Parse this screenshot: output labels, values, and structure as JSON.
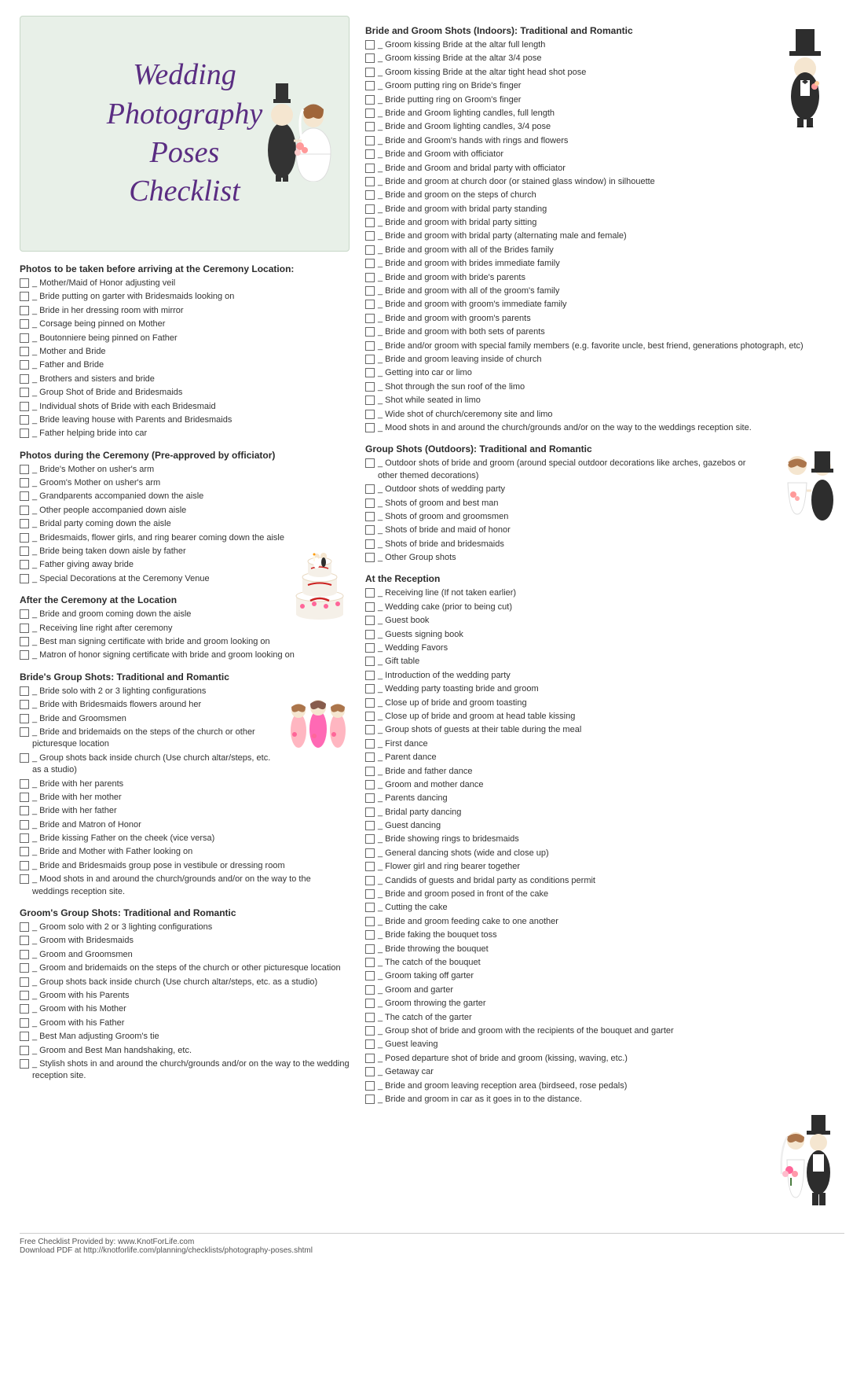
{
  "title": {
    "line1": "Wedding",
    "line2": "Photography",
    "line3": "Poses",
    "line4": "Checklist"
  },
  "sections": {
    "before_ceremony": {
      "header": "Photos to be taken before arriving at the Ceremony Location:",
      "items": [
        "Mother/Maid of Honor adjusting veil",
        "Bride putting on garter with Bridesmaids looking on",
        "Bride in her dressing room with mirror",
        "Corsage being pinned on Mother",
        "Boutonniere being pinned on Father",
        "Mother and Bride",
        "Father and Bride",
        "Brothers and sisters and bride",
        "Group Shot of Bride and Bridesmaids",
        "Individual shots of Bride with each Bridesmaid",
        "Bride leaving house with Parents and Bridesmaids",
        "Father helping bride into car"
      ]
    },
    "during_ceremony": {
      "header": "Photos during the Ceremony (Pre-approved by officiator)",
      "items": [
        "Bride's Mother on usher's arm",
        "Groom's Mother on usher's arm",
        "Grandparents accompanied down the aisle",
        "Other people accompanied down aisle",
        "Bridal party coming down the aisle",
        "Bridesmaids, flower girls, and ring bearer coming down the aisle",
        "Bride being taken down aisle by father",
        "Father giving away bride",
        "Special Decorations at the Ceremony Venue"
      ]
    },
    "after_ceremony": {
      "header": "After the Ceremony at the Location",
      "items": [
        "Bride and groom coming down the aisle",
        "Receiving line right after ceremony",
        "Best man signing certificate with bride and groom looking on",
        "Matron of honor signing certificate with bride and groom looking on"
      ]
    },
    "brides_group": {
      "header": "Bride's Group Shots: Traditional and Romantic",
      "items": [
        "Bride solo with 2 or 3 lighting configurations",
        "Bride with Bridesmaids flowers around her",
        "Bride and Groomsmen",
        "Bride and bridemaids on the steps of the church or other picturesque location",
        "Group shots back inside church  (Use church altar/steps, etc. as a studio)",
        "Bride with her parents",
        "Bride with her mother",
        "Bride with her father",
        "Bride and Matron of Honor",
        "Bride kissing Father on the cheek (vice versa)",
        "Bride and Mother with Father looking on",
        "Bride and Bridesmaids group pose in vestibule or dressing room",
        "Mood shots in and around the church/grounds and/or  on the way to the weddings reception site."
      ]
    },
    "grooms_group": {
      "header": "Groom's Group Shots: Traditional and Romantic",
      "items": [
        "Groom solo with 2 or 3 lighting configurations",
        "Groom with Bridesmaids",
        "Groom and Groomsmen",
        "Groom and bridemaids on the steps of the church or other picturesque location",
        "Group shots back inside church  (Use church altar/steps, etc. as a studio)",
        "Groom with his Parents",
        "Groom with his Mother",
        "Groom with his Father",
        "Best Man adjusting Groom's tie",
        "Groom and Best Man handshaking, etc.",
        "Stylish shots in and around the church/grounds and/or  on the way to the wedding reception site."
      ]
    },
    "bride_groom_indoors": {
      "header": "Bride and Groom Shots (Indoors): Traditional and Romantic",
      "items": [
        "Groom kissing Bride at the altar full length",
        "Groom kissing Bride at the altar 3/4 pose",
        "Groom kissing Bride at the altar tight head shot pose",
        "Groom putting ring on Bride's finger",
        "Bride putting ring on Groom's finger",
        "Bride and Groom lighting candles, full length",
        "Bride and Groom lighting candles, 3/4 pose",
        "Bride and Groom's hands with rings and flowers",
        "Bride and Groom with officiator",
        "Bride and Groom and bridal party with officiator",
        "Bride and groom at church door (or stained glass window) in silhouette",
        "Bride and groom on the steps of church",
        "Bride and groom with bridal party standing",
        "Bride and groom with bridal party sitting",
        "Bride and groom with bridal party  (alternating male and female)",
        "Bride and groom with all of the Brides family",
        "Bride and groom with brides immediate family",
        "Bride and groom with bride's parents",
        "Bride and groom with all of the groom's family",
        "Bride and groom with groom's immediate family",
        "Bride and groom with groom's parents",
        "Bride and groom with both sets of parents",
        "Bride and/or groom with special family members  (e.g. favorite uncle, best friend, generations photograph, etc)",
        "Bride and groom leaving inside of church",
        "Getting into car or limo",
        "Shot through the sun roof of the limo",
        "Shot while seated in limo",
        "Wide shot of church/ceremony site and limo",
        "Mood shots in and around the church/grounds and/or  on the way to the weddings reception site."
      ]
    },
    "group_outdoors": {
      "header": "Group Shots (Outdoors): Traditional and Romantic",
      "items": [
        "Outdoor shots of bride and groom (around special outdoor decorations like arches, gazebos or other themed decorations)",
        "Outdoor shots of wedding party",
        "Shots of groom and best man",
        "Shots of groom and groomsmen",
        "Shots of bride and maid of honor",
        "Shots of bride and bridesmaids",
        "Other Group shots"
      ]
    },
    "reception": {
      "header": "At the Reception",
      "items": [
        "Receiving line (If not taken earlier)",
        "Wedding cake (prior to being cut)",
        "Guest book",
        "Guests signing book",
        "Wedding Favors",
        "Gift table",
        "Introduction of the wedding party",
        "Wedding party toasting bride and groom",
        "Close up of bride and groom toasting",
        "Close up of bride and groom at head table kissing",
        "Group shots of guests at their table during the meal",
        "First dance",
        "Parent dance",
        "Bride and father dance",
        "Groom and mother dance",
        "Parents dancing",
        "Bridal party dancing",
        "Guest dancing",
        "Bride showing rings to bridesmaids",
        "General dancing shots (wide and close up)",
        "Flower girl and ring bearer together",
        "Candids of guests and bridal party as conditions permit",
        "Bride and groom posed in front of the cake",
        "Cutting the cake",
        "Bride and groom feeding cake to one another",
        "Bride faking the bouquet toss",
        "Bride throwing the bouquet",
        "The catch of the bouquet",
        "Groom taking off garter",
        "Groom and garter",
        "Groom throwing the garter",
        "The catch of the garter",
        "Group shot of bride and groom with the recipients of the  bouquet and garter",
        "Guest leaving",
        "Posed departure shot of bride and groom (kissing, waving, etc.)",
        "Getaway car",
        "Bride and groom leaving reception area (birdseed, rose pedals)",
        "Bride and groom in car as it goes in to the distance."
      ]
    }
  },
  "footer": {
    "line1": "Free Checklist Provided by: www.KnotForLife.com",
    "line2": "Download PDF at http://knotforlife.com/planning/checklists/photography-poses.shtml"
  }
}
